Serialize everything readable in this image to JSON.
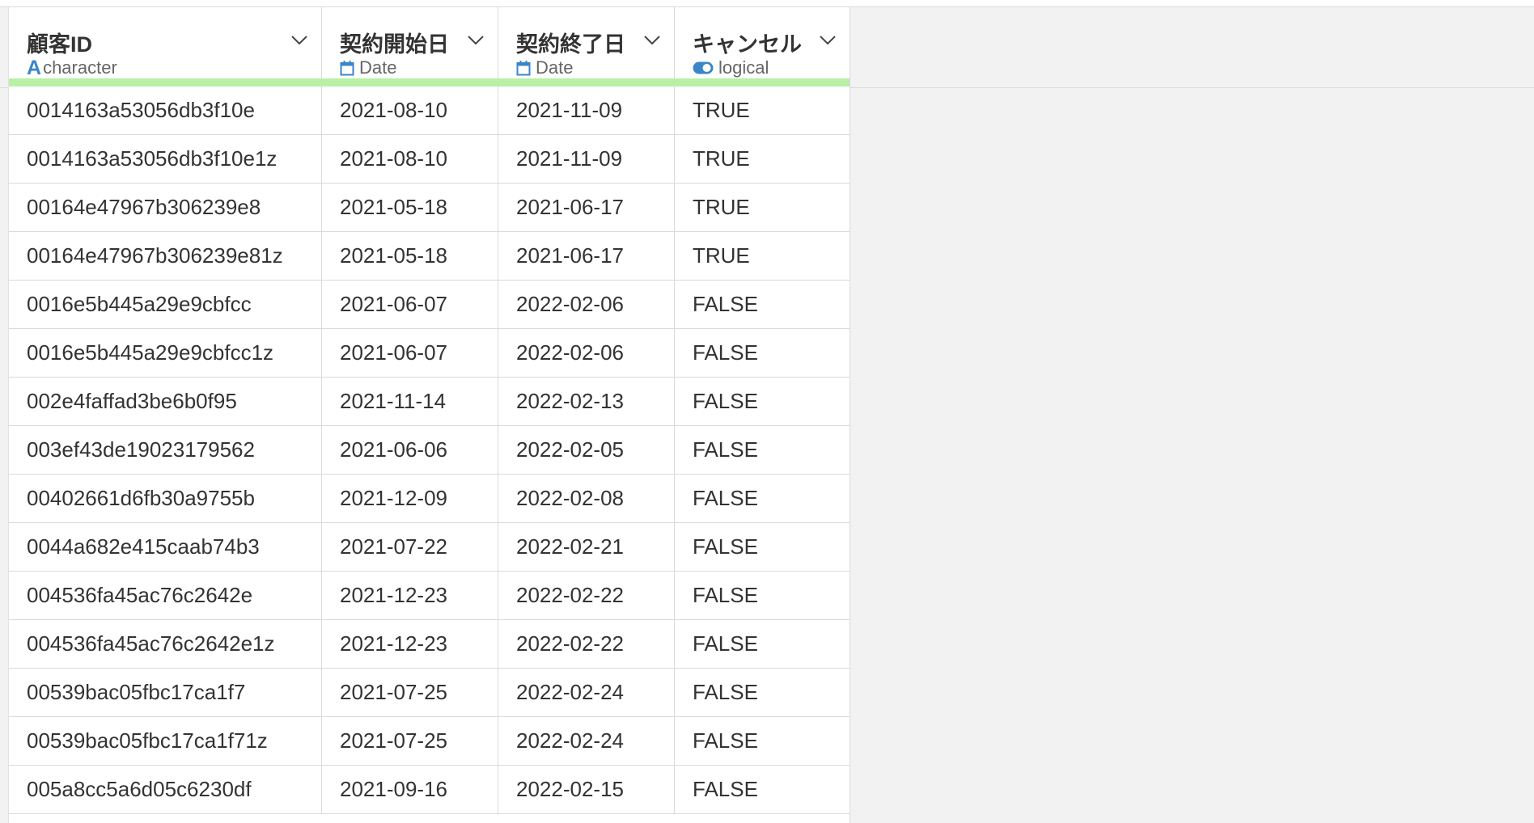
{
  "columns": [
    {
      "name": "顧客ID",
      "type": "character",
      "type_icon": "character-type-icon"
    },
    {
      "name": "契約開始日",
      "type": "Date",
      "type_icon": "calendar-icon"
    },
    {
      "name": "契約終了日",
      "type": "Date",
      "type_icon": "calendar-icon"
    },
    {
      "name": "キャンセル",
      "type": "logical",
      "type_icon": "toggle-icon"
    }
  ],
  "type_icon_char_glyph": "A",
  "colors": {
    "accent_blue": "#3a86c8",
    "header_bar_green": "#b8f0a6"
  },
  "rows": [
    [
      "0014163a53056db3f10e",
      "2021-08-10",
      "2021-11-09",
      "TRUE"
    ],
    [
      "0014163a53056db3f10e1z",
      "2021-08-10",
      "2021-11-09",
      "TRUE"
    ],
    [
      "00164e47967b306239e8",
      "2021-05-18",
      "2021-06-17",
      "TRUE"
    ],
    [
      "00164e47967b306239e81z",
      "2021-05-18",
      "2021-06-17",
      "TRUE"
    ],
    [
      "0016e5b445a29e9cbfcc",
      "2021-06-07",
      "2022-02-06",
      "FALSE"
    ],
    [
      "0016e5b445a29e9cbfcc1z",
      "2021-06-07",
      "2022-02-06",
      "FALSE"
    ],
    [
      "002e4faffad3be6b0f95",
      "2021-11-14",
      "2022-02-13",
      "FALSE"
    ],
    [
      "003ef43de19023179562",
      "2021-06-06",
      "2022-02-05",
      "FALSE"
    ],
    [
      "00402661d6fb30a9755b",
      "2021-12-09",
      "2022-02-08",
      "FALSE"
    ],
    [
      "0044a682e415caab74b3",
      "2021-07-22",
      "2022-02-21",
      "FALSE"
    ],
    [
      "004536fa45ac76c2642e",
      "2021-12-23",
      "2022-02-22",
      "FALSE"
    ],
    [
      "004536fa45ac76c2642e1z",
      "2021-12-23",
      "2022-02-22",
      "FALSE"
    ],
    [
      "00539bac05fbc17ca1f7",
      "2021-07-25",
      "2022-02-24",
      "FALSE"
    ],
    [
      "00539bac05fbc17ca1f71z",
      "2021-07-25",
      "2022-02-24",
      "FALSE"
    ],
    [
      "005a8cc5a6d05c6230df",
      "2021-09-16",
      "2022-02-15",
      "FALSE"
    ]
  ]
}
